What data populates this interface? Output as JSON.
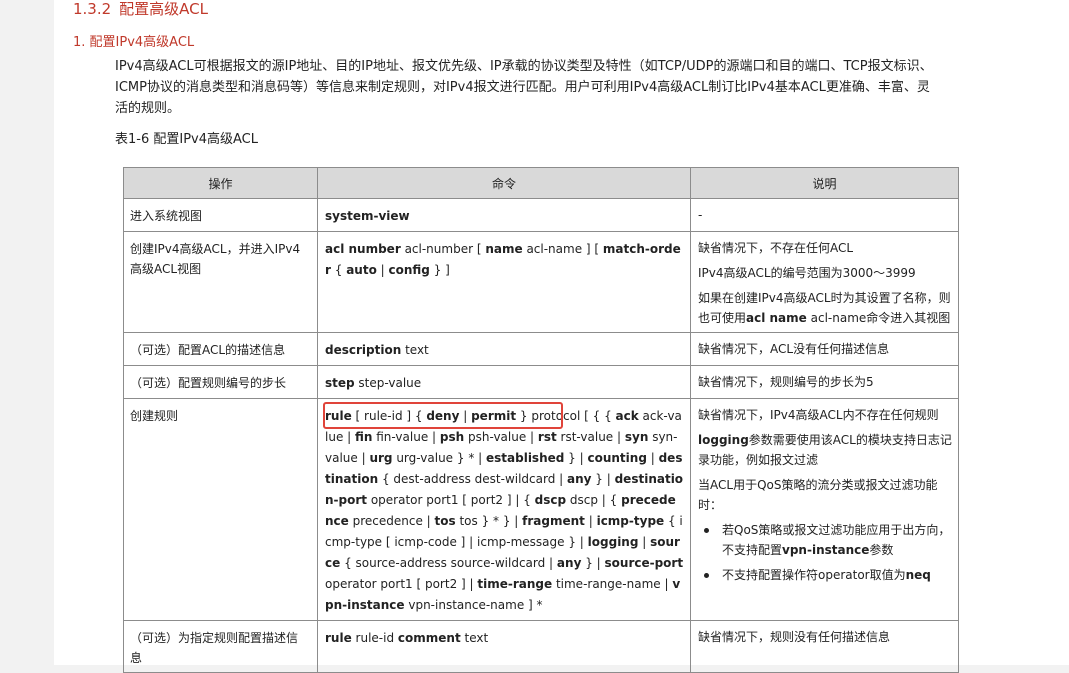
{
  "section": {
    "number": "1.3.2",
    "title": "配置高级ACL"
  },
  "subsection": {
    "title": "1. 配置IPv4高级ACL"
  },
  "intro_lines": [
    "IPv4高级ACL可根据报文的源IP地址、目的IP地址、报文优先级、IP承载的协议类型及特性（如TCP/UDP的源端口和目的端口、TCP报文标识、",
    "ICMP协议的消息类型和消息码等）等信息来制定规则，对IPv4报文进行匹配。用户可利用IPv4高级ACL制订比IPv4基本ACL更准确、丰富、灵",
    "活的规则。"
  ],
  "table": {
    "caption": "表1-6 配置IPv4高级ACL",
    "headers": [
      "操作",
      "命令",
      "说明"
    ],
    "rows": [
      {
        "op": "进入系统视图",
        "cmd": [
          [
            "b",
            "system-view"
          ]
        ],
        "desc": [
          [
            "-"
          ]
        ]
      },
      {
        "op": "创建IPv4高级ACL，并进入IPv4高级ACL视图",
        "cmd": [
          [
            "b",
            "acl number"
          ],
          [
            "t",
            " acl-number [ "
          ],
          [
            "b",
            "name"
          ],
          [
            "t",
            " acl-name ] [ "
          ],
          [
            "b",
            "match-order"
          ],
          [
            "t",
            " { "
          ],
          [
            "b",
            "auto"
          ],
          [
            "t",
            " | "
          ],
          [
            "b",
            "config"
          ],
          [
            "t",
            " } ]"
          ]
        ],
        "desc": [
          [
            [
              "t",
              "缺省情况下，不存在任何ACL"
            ]
          ],
          [
            [
              "t",
              "IPv4高级ACL的编号范围为3000～3999"
            ]
          ],
          [
            [
              "t",
              "如果在创建IPv4高级ACL时为其设置了名称，则也可使用"
            ],
            [
              "b",
              "acl name"
            ],
            [
              "t",
              " acl-name命令进入其视图"
            ]
          ]
        ]
      },
      {
        "op": "（可选）配置ACL的描述信息",
        "cmd": [
          [
            "b",
            "description"
          ],
          [
            "t",
            " text"
          ]
        ],
        "desc": [
          [
            [
              "t",
              "缺省情况下，ACL没有任何描述信息"
            ]
          ]
        ]
      },
      {
        "op": "（可选）配置规则编号的步长",
        "cmd": [
          [
            "b",
            "step"
          ],
          [
            "t",
            " step-value"
          ]
        ],
        "desc": [
          [
            [
              "t",
              "缺省情况下，规则编号的步长为5"
            ]
          ]
        ]
      },
      {
        "op": "创建规则",
        "cmd": [
          [
            "b",
            "rule"
          ],
          [
            "t",
            " [ rule-id ] { "
          ],
          [
            "b",
            "deny"
          ],
          [
            "t",
            " | "
          ],
          [
            "b",
            "permit"
          ],
          [
            "t",
            " } protocol [ { { "
          ],
          [
            "b",
            "ack"
          ],
          [
            "t",
            " ack-value | "
          ],
          [
            "b",
            "fin"
          ],
          [
            "t",
            " fin-value | "
          ],
          [
            "b",
            "psh"
          ],
          [
            "t",
            " psh-value | "
          ],
          [
            "b",
            "rst"
          ],
          [
            "t",
            " rst-value | "
          ],
          [
            "b",
            "syn"
          ],
          [
            "t",
            " syn-value | "
          ],
          [
            "b",
            "urg"
          ],
          [
            "t",
            " urg-value } * | "
          ],
          [
            "b",
            "established"
          ],
          [
            "t",
            " } | "
          ],
          [
            "b",
            "counting"
          ],
          [
            "t",
            " | "
          ],
          [
            "b",
            "destination"
          ],
          [
            "t",
            " { dest-address dest-wildcard | "
          ],
          [
            "b",
            "any"
          ],
          [
            "t",
            " } | "
          ],
          [
            "b",
            "destination-port"
          ],
          [
            "t",
            " operator port1 [ port2 ] | { "
          ],
          [
            "b",
            "dscp"
          ],
          [
            "t",
            " dscp | { "
          ],
          [
            "b",
            "precedence"
          ],
          [
            "t",
            " precedence | "
          ],
          [
            "b",
            "tos"
          ],
          [
            "t",
            " tos } * } | "
          ],
          [
            "b",
            "fragment"
          ],
          [
            "t",
            " | "
          ],
          [
            "b",
            "icmp-type"
          ],
          [
            "t",
            " { icmp-type [ icmp-code ] | icmp-message } | "
          ],
          [
            "b",
            "logging"
          ],
          [
            "t",
            " | "
          ],
          [
            "b",
            "source"
          ],
          [
            "t",
            " { source-address source-wildcard | "
          ],
          [
            "b",
            "any"
          ],
          [
            "t",
            " } | "
          ],
          [
            "b",
            "source-port"
          ],
          [
            "t",
            " operator port1 [ port2 ] | "
          ],
          [
            "b",
            "time-range"
          ],
          [
            "t",
            " time-range-name | "
          ],
          [
            "b",
            "vpn-instance"
          ],
          [
            "t",
            " vpn-instance-name ] *"
          ]
        ],
        "desc": [
          [
            [
              "t",
              "缺省情况下，IPv4高级ACL内不存在任何规则"
            ]
          ],
          [
            [
              "b",
              "logging"
            ],
            [
              "t",
              "参数需要使用该ACL的模块支持日志记录功能，例如报文过滤"
            ]
          ],
          [
            [
              "t",
              "当ACL用于QoS策略的流分类或报文过滤功能时："
            ]
          ]
        ],
        "bullets": [
          [
            [
              "t",
              "若QoS策略或报文过滤功能应用于出方向，不支持配置"
            ],
            [
              "b",
              "vpn-instance"
            ],
            [
              "t",
              "参数"
            ]
          ],
          [
            [
              "t",
              "不支持配置操作符operator取值为"
            ],
            [
              "b",
              "neq"
            ]
          ]
        ],
        "highlight": true
      },
      {
        "op": "（可选）为指定规则配置描述信息",
        "cmd": [
          [
            "b",
            "rule"
          ],
          [
            "t",
            " rule-id "
          ],
          [
            "b",
            "comment"
          ],
          [
            "t",
            " text"
          ]
        ],
        "desc": [
          [
            [
              "t",
              "缺省情况下，规则没有任何描述信息"
            ]
          ]
        ]
      }
    ]
  },
  "colors": {
    "heading": "#c0392b",
    "header_bg": "#d9d9d9",
    "highlight_box": "#e0443a",
    "border": "#8c8c8c"
  }
}
